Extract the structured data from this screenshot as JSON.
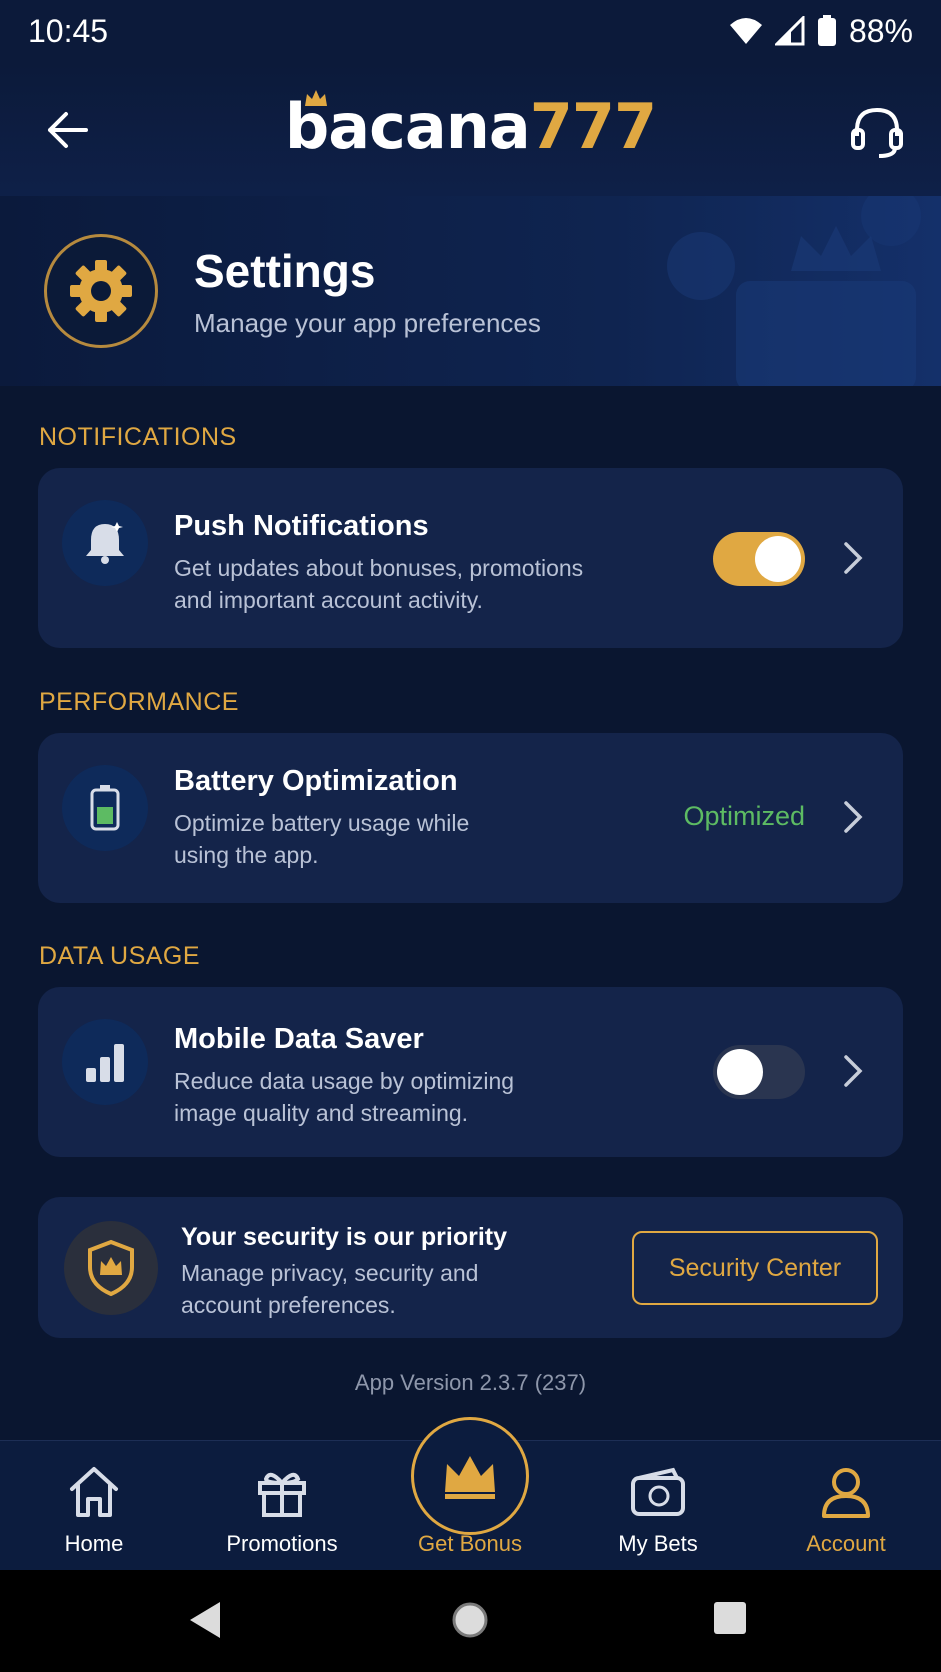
{
  "status_bar": {
    "time": "10:45",
    "battery": "88%"
  },
  "header": {
    "logo_main": "bacana",
    "logo_num": "777"
  },
  "hero": {
    "title": "Settings",
    "subtitle": "Manage your app preferences"
  },
  "sections": {
    "notifications": {
      "label": "NOTIFICATIONS",
      "title": "Push Notifications",
      "desc": "Get updates about bonuses, promotions and important account activity.",
      "enabled": true
    },
    "performance": {
      "label": "PERFORMANCE",
      "title": "Battery Optimization",
      "desc": "Optimize battery usage while using the app.",
      "status": "Optimized"
    },
    "data_usage": {
      "label": "DATA USAGE",
      "title": "Mobile Data Saver",
      "desc": "Reduce data usage by optimizing image quality and streaming.",
      "enabled": false
    }
  },
  "security": {
    "title": "Your security is our priority",
    "desc": "Manage privacy, security and account preferences.",
    "button": "Security Center"
  },
  "app_version": "App Version 2.3.7 (237)",
  "bottom_nav": [
    {
      "label": "Home",
      "icon": "home-icon"
    },
    {
      "label": "Promotions",
      "icon": "gift-icon"
    },
    {
      "label": "Get Bonus",
      "icon": "crown-icon"
    },
    {
      "label": "My Bets",
      "icon": "wallet-icon"
    },
    {
      "label": "Account",
      "icon": "user-icon"
    }
  ],
  "colors": {
    "accent": "#e0a842",
    "background": "#0a1630",
    "card": "#14244a",
    "success": "#5dbb63"
  }
}
